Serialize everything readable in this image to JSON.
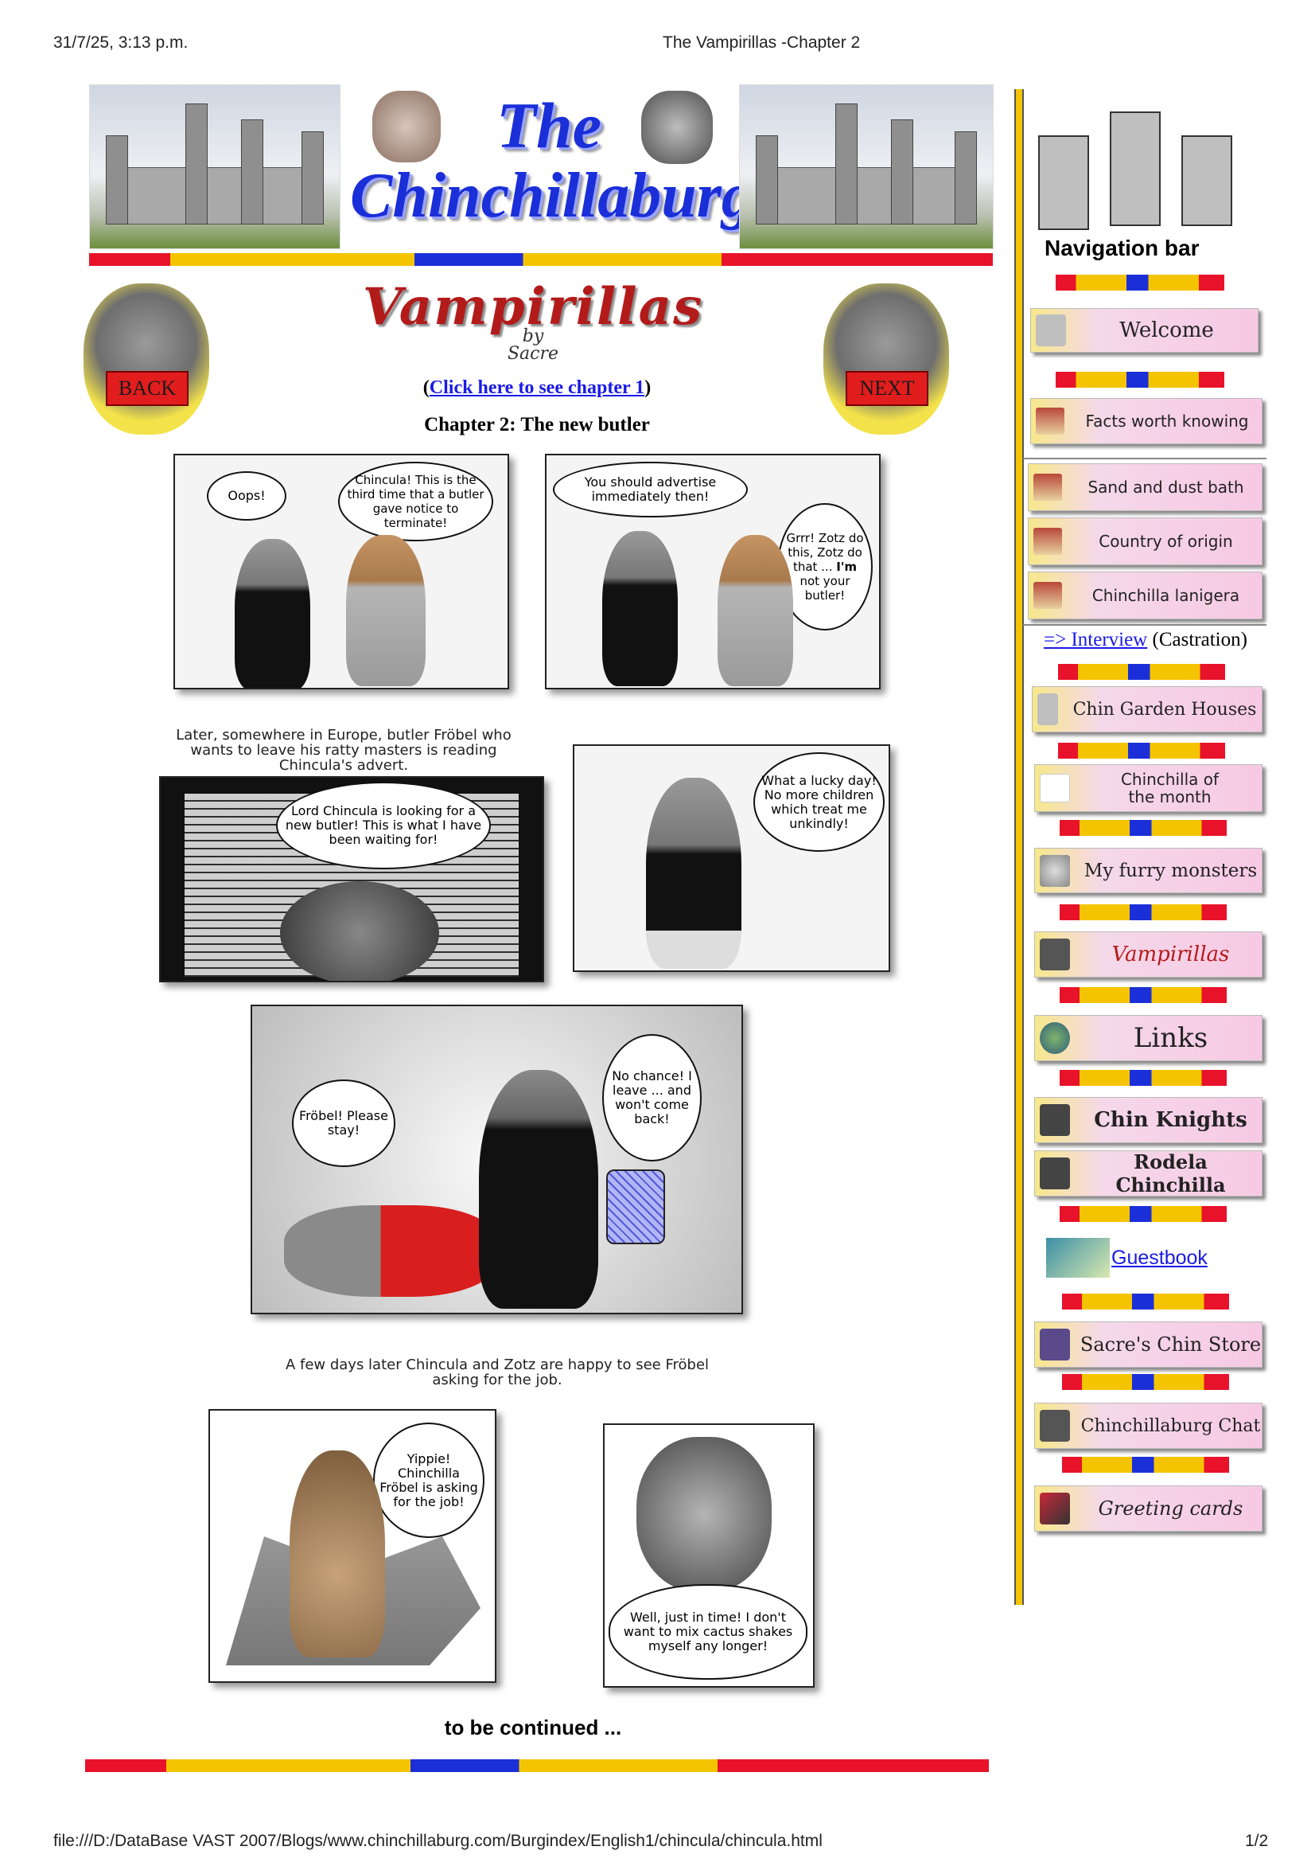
{
  "print_header": {
    "datetime": "31/7/25, 3:13 p.m.",
    "doc_title": "The Vampirillas -Chapter 2"
  },
  "print_footer": {
    "path": "file:///D:/DataBase VAST 2007/Blogs/www.chinchillaburg.com/Burgindex/English1/chincula/chincula.html",
    "page": "1/2"
  },
  "header": {
    "logo_line1": "The",
    "logo_line2": "Chinchillaburg"
  },
  "title_block": {
    "title": "Vampirillas",
    "by_line1": "by",
    "by_line2": "Sacre",
    "back_label": "BACK",
    "next_label": "NEXT",
    "chapter1_prefix": "(",
    "chapter1_link": "Click here to see chapter 1",
    "chapter1_suffix": ")",
    "chapter_heading": "Chapter 2: The new butler"
  },
  "comic": {
    "p1_b1": "Oops!",
    "p1_b2": "Chincula! This is the third time that a butler gave notice to terminate!",
    "p2_b1": "You should advertise immediately then!",
    "p2_b2a": "Grrr! Zotz do this, Zotz do that ... ",
    "p2_b2_em": "I'm",
    "p2_b2b": " not your butler!",
    "caption1": "Later, somewhere in Europe, butler Fröbel who wants to leave his ratty masters is reading Chincula's advert.",
    "p3_b1": "Lord Chincula is looking for a new butler! This is what I have been waiting for!",
    "p4_b1": "What a lucky day! No more children which treat me unkindly!",
    "p5_b1": "Fröbel! Please stay!",
    "p5_b2": "No chance! I leave ... and won't come back!",
    "caption2": "A few days later Chincula and Zotz are happy to see Fröbel asking for the job.",
    "p6_b1": "Yippie! Chinchilla Fröbel is asking for the job!",
    "p7_b1": "Well, just in time! I don't want to mix cactus shakes myself any longer!",
    "continued": "to be continued ..."
  },
  "nav": {
    "heading": "Navigation bar",
    "welcome": "Welcome",
    "facts": "Facts worth knowing",
    "sand": "Sand and dust bath",
    "country": "Country of origin",
    "lanigera": "Chinchilla lanigera",
    "interview_link": "=> Interview",
    "interview_note": "(Castration)",
    "garden": "Chin Garden Houses",
    "month_line1": "Chinchilla of",
    "month_line2": "the month",
    "monsters": "My furry monsters",
    "vampirillas": "Vampirillas",
    "links": "Links",
    "knights": "Chin Knights",
    "rodela": "Rodela Chinchilla",
    "guestbook": "Guestbook",
    "store": "Sacre's Chin Store",
    "chat": "Chinchillaburg Chat",
    "cards": "Greeting cards"
  },
  "colors": {
    "rule_red": "#e8122a",
    "rule_yellow": "#f5c400",
    "rule_blue": "#1a2fd8",
    "link": "#1a1ae6",
    "nav_border": "#d9b300"
  }
}
